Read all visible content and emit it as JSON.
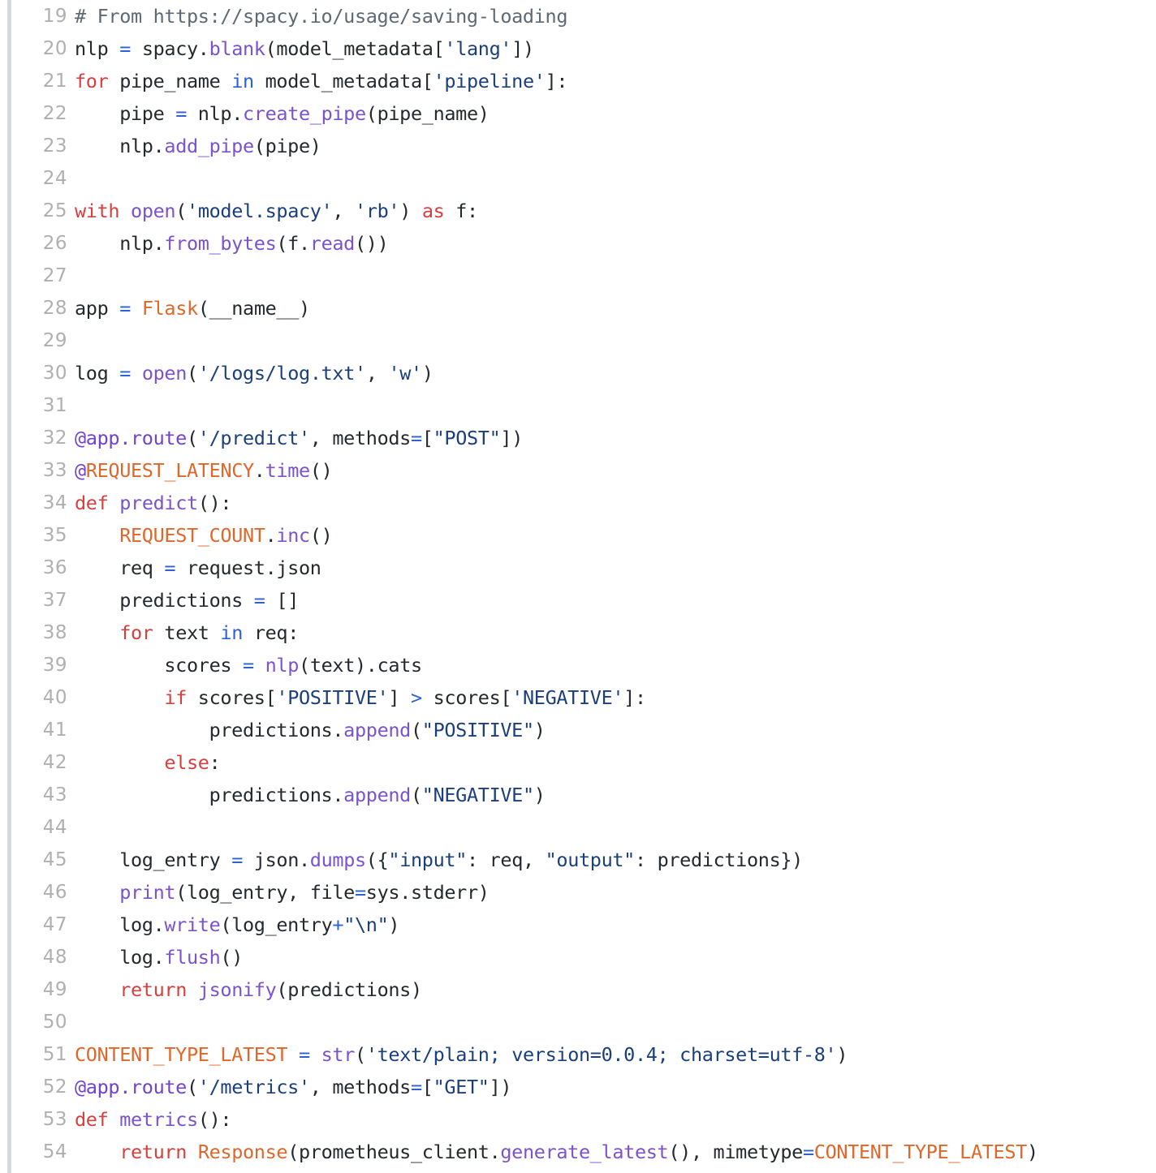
{
  "viewer": {
    "title": "python-source-snippet",
    "language": "Python",
    "first_line_number": 19,
    "last_line_number": 54,
    "line_height_px": 40,
    "colors": {
      "background": "#ffffff",
      "gutter_rule": "#d5d7de",
      "line_number": "#b0b0b0",
      "plain_text": "#24292e",
      "comment": "#5d6973",
      "keyword": "#d6403f",
      "operator": "#2b62d9",
      "string": "#1b3f7d",
      "builtin": "#7b52cf",
      "function": "#7b52cf",
      "decorator": "#6f42d1",
      "constant": "#e0672a"
    }
  },
  "lines": [
    {
      "number": "19",
      "text": "# From https://spacy.io/usage/saving-loading",
      "tokens": [
        {
          "t": "# From https://spacy.io/usage/saving-loading",
          "c": "tok-comment"
        }
      ]
    },
    {
      "number": "20",
      "text": "nlp = spacy.blank(model_metadata['lang'])",
      "tokens": [
        {
          "t": "nlp ",
          "c": "tok-plain"
        },
        {
          "t": "=",
          "c": "tok-operator"
        },
        {
          "t": " spacy.",
          "c": "tok-plain"
        },
        {
          "t": "blank",
          "c": "tok-builtin"
        },
        {
          "t": "(model_metadata[",
          "c": "tok-plain"
        },
        {
          "t": "'lang'",
          "c": "tok-string"
        },
        {
          "t": "])",
          "c": "tok-plain"
        }
      ]
    },
    {
      "number": "21",
      "text": "for pipe_name in model_metadata['pipeline']:",
      "tokens": [
        {
          "t": "for",
          "c": "tok-keyword"
        },
        {
          "t": " pipe_name ",
          "c": "tok-plain"
        },
        {
          "t": "in",
          "c": "tok-operator"
        },
        {
          "t": " model_metadata[",
          "c": "tok-plain"
        },
        {
          "t": "'pipeline'",
          "c": "tok-string"
        },
        {
          "t": "]:",
          "c": "tok-plain"
        }
      ]
    },
    {
      "number": "22",
      "text": "    pipe = nlp.create_pipe(pipe_name)",
      "tokens": [
        {
          "t": "    pipe ",
          "c": "tok-plain"
        },
        {
          "t": "=",
          "c": "tok-operator"
        },
        {
          "t": " nlp.",
          "c": "tok-plain"
        },
        {
          "t": "create_pipe",
          "c": "tok-func"
        },
        {
          "t": "(pipe_name)",
          "c": "tok-plain"
        }
      ]
    },
    {
      "number": "23",
      "text": "    nlp.add_pipe(pipe)",
      "tokens": [
        {
          "t": "    nlp.",
          "c": "tok-plain"
        },
        {
          "t": "add_pipe",
          "c": "tok-func"
        },
        {
          "t": "(pipe)",
          "c": "tok-plain"
        }
      ]
    },
    {
      "number": "24",
      "text": "",
      "tokens": []
    },
    {
      "number": "25",
      "text": "with open('model.spacy', 'rb') as f:",
      "tokens": [
        {
          "t": "with",
          "c": "tok-keyword"
        },
        {
          "t": " ",
          "c": "tok-plain"
        },
        {
          "t": "open",
          "c": "tok-builtin"
        },
        {
          "t": "(",
          "c": "tok-plain"
        },
        {
          "t": "'model.spacy'",
          "c": "tok-string"
        },
        {
          "t": ", ",
          "c": "tok-plain"
        },
        {
          "t": "'rb'",
          "c": "tok-string"
        },
        {
          "t": ") ",
          "c": "tok-plain"
        },
        {
          "t": "as",
          "c": "tok-keyword"
        },
        {
          "t": " f:",
          "c": "tok-plain"
        }
      ]
    },
    {
      "number": "26",
      "text": "    nlp.from_bytes(f.read())",
      "tokens": [
        {
          "t": "    nlp.",
          "c": "tok-plain"
        },
        {
          "t": "from_bytes",
          "c": "tok-func"
        },
        {
          "t": "(f.",
          "c": "tok-plain"
        },
        {
          "t": "read",
          "c": "tok-func"
        },
        {
          "t": "())",
          "c": "tok-plain"
        }
      ]
    },
    {
      "number": "27",
      "text": "",
      "tokens": []
    },
    {
      "number": "28",
      "text": "app = Flask(__name__)",
      "tokens": [
        {
          "t": "app ",
          "c": "tok-plain"
        },
        {
          "t": "=",
          "c": "tok-operator"
        },
        {
          "t": " ",
          "c": "tok-plain"
        },
        {
          "t": "Flask",
          "c": "tok-class"
        },
        {
          "t": "(__name__)",
          "c": "tok-plain"
        }
      ]
    },
    {
      "number": "29",
      "text": "",
      "tokens": []
    },
    {
      "number": "30",
      "text": "log = open('/logs/log.txt', 'w')",
      "tokens": [
        {
          "t": "log ",
          "c": "tok-plain"
        },
        {
          "t": "=",
          "c": "tok-operator"
        },
        {
          "t": " ",
          "c": "tok-plain"
        },
        {
          "t": "open",
          "c": "tok-builtin"
        },
        {
          "t": "(",
          "c": "tok-plain"
        },
        {
          "t": "'/logs/log.txt'",
          "c": "tok-string"
        },
        {
          "t": ", ",
          "c": "tok-plain"
        },
        {
          "t": "'w'",
          "c": "tok-string"
        },
        {
          "t": ")",
          "c": "tok-plain"
        }
      ]
    },
    {
      "number": "31",
      "text": "",
      "tokens": []
    },
    {
      "number": "32",
      "text": "@app.route('/predict', methods=[\"POST\"])",
      "tokens": [
        {
          "t": "@app.route",
          "c": "tok-decorator"
        },
        {
          "t": "(",
          "c": "tok-plain"
        },
        {
          "t": "'/predict'",
          "c": "tok-string"
        },
        {
          "t": ", methods",
          "c": "tok-plain"
        },
        {
          "t": "=",
          "c": "tok-operator"
        },
        {
          "t": "[",
          "c": "tok-plain"
        },
        {
          "t": "\"POST\"",
          "c": "tok-string"
        },
        {
          "t": "])",
          "c": "tok-plain"
        }
      ]
    },
    {
      "number": "33",
      "text": "@REQUEST_LATENCY.time()",
      "tokens": [
        {
          "t": "@",
          "c": "tok-decorator"
        },
        {
          "t": "REQUEST_LATENCY",
          "c": "tok-const"
        },
        {
          "t": ".",
          "c": "tok-plain"
        },
        {
          "t": "time",
          "c": "tok-func"
        },
        {
          "t": "()",
          "c": "tok-plain"
        }
      ]
    },
    {
      "number": "34",
      "text": "def predict():",
      "tokens": [
        {
          "t": "def",
          "c": "tok-keyword"
        },
        {
          "t": " ",
          "c": "tok-plain"
        },
        {
          "t": "predict",
          "c": "tok-func"
        },
        {
          "t": "():",
          "c": "tok-plain"
        }
      ]
    },
    {
      "number": "35",
      "text": "    REQUEST_COUNT.inc()",
      "tokens": [
        {
          "t": "    ",
          "c": "tok-plain"
        },
        {
          "t": "REQUEST_COUNT",
          "c": "tok-const"
        },
        {
          "t": ".",
          "c": "tok-plain"
        },
        {
          "t": "inc",
          "c": "tok-func"
        },
        {
          "t": "()",
          "c": "tok-plain"
        }
      ]
    },
    {
      "number": "36",
      "text": "    req = request.json",
      "tokens": [
        {
          "t": "    req ",
          "c": "tok-plain"
        },
        {
          "t": "=",
          "c": "tok-operator"
        },
        {
          "t": " request.json",
          "c": "tok-plain"
        }
      ]
    },
    {
      "number": "37",
      "text": "    predictions = []",
      "tokens": [
        {
          "t": "    predictions ",
          "c": "tok-plain"
        },
        {
          "t": "=",
          "c": "tok-operator"
        },
        {
          "t": " []",
          "c": "tok-plain"
        }
      ]
    },
    {
      "number": "38",
      "text": "    for text in req:",
      "tokens": [
        {
          "t": "    ",
          "c": "tok-plain"
        },
        {
          "t": "for",
          "c": "tok-keyword"
        },
        {
          "t": " text ",
          "c": "tok-plain"
        },
        {
          "t": "in",
          "c": "tok-operator"
        },
        {
          "t": " req:",
          "c": "tok-plain"
        }
      ]
    },
    {
      "number": "39",
      "text": "        scores = nlp(text).cats",
      "tokens": [
        {
          "t": "        scores ",
          "c": "tok-plain"
        },
        {
          "t": "=",
          "c": "tok-operator"
        },
        {
          "t": " ",
          "c": "tok-plain"
        },
        {
          "t": "nlp",
          "c": "tok-func"
        },
        {
          "t": "(text).cats",
          "c": "tok-plain"
        }
      ]
    },
    {
      "number": "40",
      "text": "        if scores['POSITIVE'] > scores['NEGATIVE']:",
      "tokens": [
        {
          "t": "        ",
          "c": "tok-plain"
        },
        {
          "t": "if",
          "c": "tok-keyword"
        },
        {
          "t": " scores[",
          "c": "tok-plain"
        },
        {
          "t": "'POSITIVE'",
          "c": "tok-string"
        },
        {
          "t": "] ",
          "c": "tok-plain"
        },
        {
          "t": ">",
          "c": "tok-operator"
        },
        {
          "t": " scores[",
          "c": "tok-plain"
        },
        {
          "t": "'NEGATIVE'",
          "c": "tok-string"
        },
        {
          "t": "]:",
          "c": "tok-plain"
        }
      ]
    },
    {
      "number": "41",
      "text": "            predictions.append(\"POSITIVE\")",
      "tokens": [
        {
          "t": "            predictions.",
          "c": "tok-plain"
        },
        {
          "t": "append",
          "c": "tok-func"
        },
        {
          "t": "(",
          "c": "tok-plain"
        },
        {
          "t": "\"POSITIVE\"",
          "c": "tok-string"
        },
        {
          "t": ")",
          "c": "tok-plain"
        }
      ]
    },
    {
      "number": "42",
      "text": "        else:",
      "tokens": [
        {
          "t": "        ",
          "c": "tok-plain"
        },
        {
          "t": "else",
          "c": "tok-keyword"
        },
        {
          "t": ":",
          "c": "tok-plain"
        }
      ]
    },
    {
      "number": "43",
      "text": "            predictions.append(\"NEGATIVE\")",
      "tokens": [
        {
          "t": "            predictions.",
          "c": "tok-plain"
        },
        {
          "t": "append",
          "c": "tok-func"
        },
        {
          "t": "(",
          "c": "tok-plain"
        },
        {
          "t": "\"NEGATIVE\"",
          "c": "tok-string"
        },
        {
          "t": ")",
          "c": "tok-plain"
        }
      ]
    },
    {
      "number": "44",
      "text": "",
      "tokens": []
    },
    {
      "number": "45",
      "text": "    log_entry = json.dumps({\"input\": req, \"output\": predictions})",
      "tokens": [
        {
          "t": "    log_entry ",
          "c": "tok-plain"
        },
        {
          "t": "=",
          "c": "tok-operator"
        },
        {
          "t": " json.",
          "c": "tok-plain"
        },
        {
          "t": "dumps",
          "c": "tok-func"
        },
        {
          "t": "({",
          "c": "tok-plain"
        },
        {
          "t": "\"input\"",
          "c": "tok-string"
        },
        {
          "t": ": req, ",
          "c": "tok-plain"
        },
        {
          "t": "\"output\"",
          "c": "tok-string"
        },
        {
          "t": ": predictions})",
          "c": "tok-plain"
        }
      ]
    },
    {
      "number": "46",
      "text": "    print(log_entry, file=sys.stderr)",
      "tokens": [
        {
          "t": "    ",
          "c": "tok-plain"
        },
        {
          "t": "print",
          "c": "tok-builtin"
        },
        {
          "t": "(log_entry, file",
          "c": "tok-plain"
        },
        {
          "t": "=",
          "c": "tok-operator"
        },
        {
          "t": "sys.stderr)",
          "c": "tok-plain"
        }
      ]
    },
    {
      "number": "47",
      "text": "    log.write(log_entry+\"\\n\")",
      "tokens": [
        {
          "t": "    log.",
          "c": "tok-plain"
        },
        {
          "t": "write",
          "c": "tok-func"
        },
        {
          "t": "(log_entry",
          "c": "tok-plain"
        },
        {
          "t": "+",
          "c": "tok-operator"
        },
        {
          "t": "\"\\n\"",
          "c": "tok-string"
        },
        {
          "t": ")",
          "c": "tok-plain"
        }
      ]
    },
    {
      "number": "48",
      "text": "    log.flush()",
      "tokens": [
        {
          "t": "    log.",
          "c": "tok-plain"
        },
        {
          "t": "flush",
          "c": "tok-func"
        },
        {
          "t": "()",
          "c": "tok-plain"
        }
      ]
    },
    {
      "number": "49",
      "text": "    return jsonify(predictions)",
      "tokens": [
        {
          "t": "    ",
          "c": "tok-plain"
        },
        {
          "t": "return",
          "c": "tok-keyword"
        },
        {
          "t": " ",
          "c": "tok-plain"
        },
        {
          "t": "jsonify",
          "c": "tok-func"
        },
        {
          "t": "(predictions)",
          "c": "tok-plain"
        }
      ]
    },
    {
      "number": "50",
      "text": "",
      "tokens": []
    },
    {
      "number": "51",
      "text": "CONTENT_TYPE_LATEST = str('text/plain; version=0.0.4; charset=utf-8')",
      "tokens": [
        {
          "t": "CONTENT_TYPE_LATEST",
          "c": "tok-const"
        },
        {
          "t": " ",
          "c": "tok-plain"
        },
        {
          "t": "=",
          "c": "tok-operator"
        },
        {
          "t": " ",
          "c": "tok-plain"
        },
        {
          "t": "str",
          "c": "tok-builtin"
        },
        {
          "t": "(",
          "c": "tok-plain"
        },
        {
          "t": "'text/plain; version=0.0.4; charset=utf-8'",
          "c": "tok-string"
        },
        {
          "t": ")",
          "c": "tok-plain"
        }
      ]
    },
    {
      "number": "52",
      "text": "@app.route('/metrics', methods=[\"GET\"])",
      "tokens": [
        {
          "t": "@app.route",
          "c": "tok-decorator"
        },
        {
          "t": "(",
          "c": "tok-plain"
        },
        {
          "t": "'/metrics'",
          "c": "tok-string"
        },
        {
          "t": ", methods",
          "c": "tok-plain"
        },
        {
          "t": "=",
          "c": "tok-operator"
        },
        {
          "t": "[",
          "c": "tok-plain"
        },
        {
          "t": "\"GET\"",
          "c": "tok-string"
        },
        {
          "t": "])",
          "c": "tok-plain"
        }
      ]
    },
    {
      "number": "53",
      "text": "def metrics():",
      "tokens": [
        {
          "t": "def",
          "c": "tok-keyword"
        },
        {
          "t": " ",
          "c": "tok-plain"
        },
        {
          "t": "metrics",
          "c": "tok-func"
        },
        {
          "t": "():",
          "c": "tok-plain"
        }
      ]
    },
    {
      "number": "54",
      "text": "    return Response(prometheus_client.generate_latest(), mimetype=CONTENT_TYPE_LATEST)",
      "tokens": [
        {
          "t": "    ",
          "c": "tok-plain"
        },
        {
          "t": "return",
          "c": "tok-keyword"
        },
        {
          "t": " ",
          "c": "tok-plain"
        },
        {
          "t": "Response",
          "c": "tok-class"
        },
        {
          "t": "(prometheus_client.",
          "c": "tok-plain"
        },
        {
          "t": "generate_latest",
          "c": "tok-func"
        },
        {
          "t": "(), mimetype",
          "c": "tok-plain"
        },
        {
          "t": "=",
          "c": "tok-operator"
        },
        {
          "t": "CONTENT_TYPE_LATEST",
          "c": "tok-const"
        },
        {
          "t": ")",
          "c": "tok-plain"
        }
      ]
    }
  ]
}
